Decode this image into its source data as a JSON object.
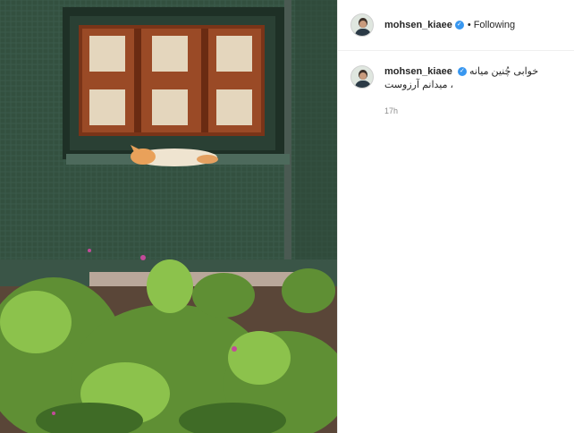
{
  "post": {
    "username": "mohsen_kiaee",
    "verified_icon": "verified-badge-icon",
    "follow_status": "Following",
    "separator": "•",
    "caption_line1": "خوابی چُنین میانه",
    "caption_line2": "، میدانم آرزوست",
    "time_ago": "17h"
  },
  "photo": {
    "subject": "cat sleeping on window ledge with green tiled wall and plants",
    "colors": {
      "tile": "#2f4a3e",
      "frame": "#8a3f1e",
      "pane": "#e6d8c0",
      "foliage": "#5f8f34"
    }
  }
}
